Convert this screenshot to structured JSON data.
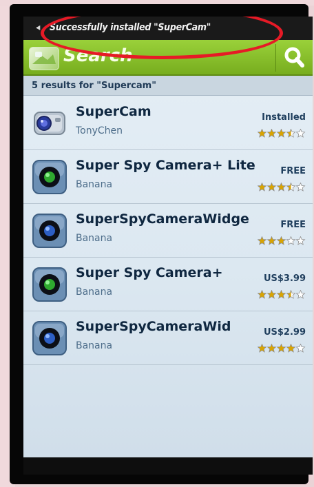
{
  "status_bar": {
    "notification": "Successfully installed \"SuperCam\""
  },
  "search_bar": {
    "placeholder": "Search"
  },
  "results": {
    "summary": "5 results for \"Supercam\"",
    "items": [
      {
        "name": "SuperCam",
        "developer": "TonyChen",
        "price": "Installed",
        "rating": 3.5,
        "icon": "camcorder-icon"
      },
      {
        "name": "Super Spy Camera+ Lite",
        "developer": "Banana",
        "price": "FREE",
        "rating": 3.5,
        "icon": "green-lens-icon"
      },
      {
        "name": "SuperSpyCameraWidge",
        "developer": "Banana",
        "price": "FREE",
        "rating": 3,
        "icon": "blue-lens-icon"
      },
      {
        "name": "Super Spy Camera+",
        "developer": "Banana",
        "price": "US$3.99",
        "rating": 3.5,
        "icon": "green-lens-icon"
      },
      {
        "name": "SuperSpyCameraWid",
        "developer": "Banana",
        "price": "US$2.99",
        "rating": 4,
        "icon": "blue-lens-icon"
      }
    ]
  },
  "colors": {
    "accent_green": "#8cc63f",
    "annotation_red": "#e61a26",
    "star_gold": "#d9a400"
  }
}
